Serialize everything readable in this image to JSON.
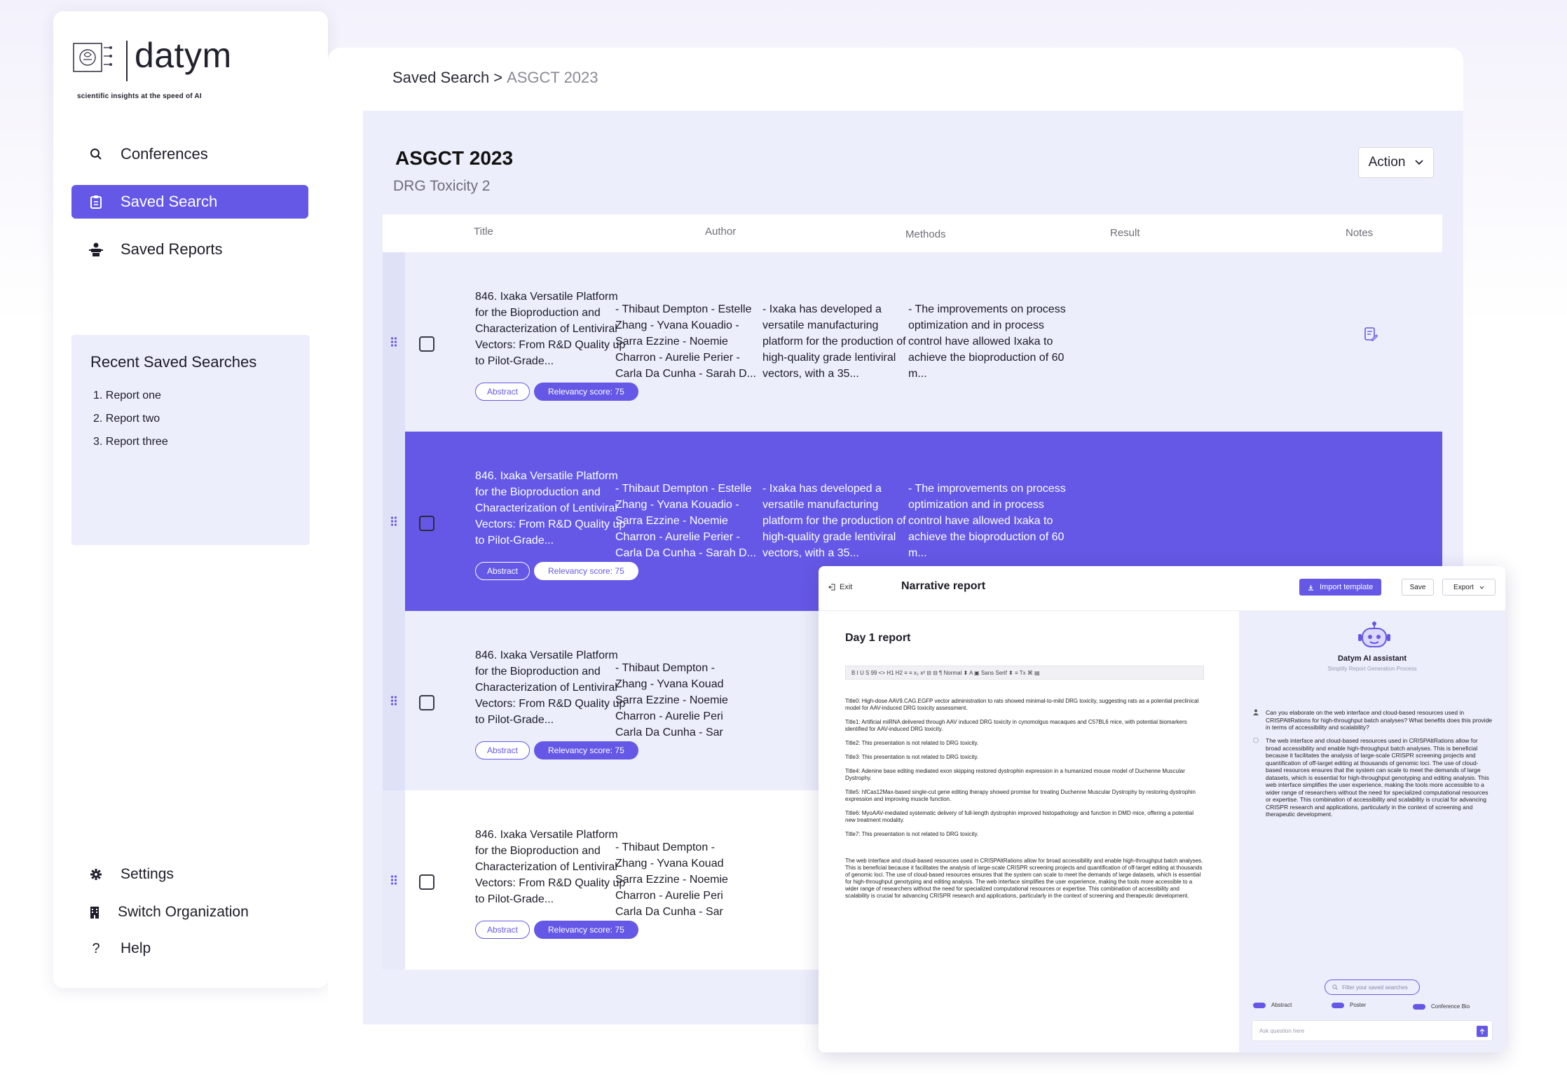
{
  "brand": {
    "name": "datym",
    "tagline": "scientific insights at the speed of AI"
  },
  "nav": {
    "conferences": "Conferences",
    "saved_search": "Saved Search",
    "saved_reports": "Saved Reports"
  },
  "recent": {
    "heading": "Recent Saved Searches",
    "items": [
      "1. Report one",
      "2. Report two",
      "3. Report three"
    ]
  },
  "bottom_nav": {
    "settings": "Settings",
    "switch_org": "Switch Organization",
    "help": "Help"
  },
  "breadcrumb": {
    "parent": "Saved Search",
    "separator": ">",
    "current": "ASGCT 2023"
  },
  "page": {
    "title": "ASGCT 2023",
    "subtitle": "DRG Toxicity 2",
    "action_label": "Action"
  },
  "table": {
    "headers": {
      "title": "Title",
      "author": "Author",
      "methods": "Methods",
      "result": "Result",
      "notes": "Notes"
    },
    "rows": [
      {
        "title": "846. Ixaka Versatile Platform for the Bioproduction and Characterization of Lentiviral Vectors: From R&D Quality up to Pilot-Grade...",
        "author": "- Thibaut Dempton - Estelle Zhang - Yvana Kouadio - Sarra Ezzine - Noemie Charron - Aurelie Perier - Carla Da Cunha - Sarah D...",
        "methods": "- Ixaka has developed a versatile manufacturing platform for the production of high-quality grade lentiviral vectors, with a 35...",
        "result": "- The improvements on process optimization and in process control have allowed Ixaka to achieve the bioproduction of 60 m...",
        "abstract": "Abstract",
        "score": "Relevancy score: 75"
      },
      {
        "title": "846. Ixaka Versatile Platform for the Bioproduction and Characterization of Lentiviral Vectors: From R&D Quality up to Pilot-Grade...",
        "author": "- Thibaut Dempton - Estelle Zhang - Yvana Kouadio - Sarra Ezzine - Noemie Charron - Aurelie Perier - Carla Da Cunha - Sarah D...",
        "methods": "- Ixaka has developed a versatile manufacturing platform for the production of high-quality grade lentiviral vectors, with a 35...",
        "result": "- The improvements on process optimization and in process control have allowed Ixaka to achieve the bioproduction of 60 m...",
        "abstract": "Abstract",
        "score": "Relevancy score: 75"
      },
      {
        "title": "846. Ixaka Versatile Platform for the Bioproduction and Characterization of Lentiviral Vectors: From R&D Quality up to Pilot-Grade...",
        "author": "- Thibaut Dempton - Zhang - Yvana Kouad Sarra Ezzine - Noemie Charron - Aurelie Peri Carla Da Cunha - Sar",
        "abstract": "Abstract",
        "score": "Relevancy score: 75"
      },
      {
        "title": "846. Ixaka Versatile Platform for the Bioproduction and Characterization of Lentiviral Vectors: From R&D Quality up to Pilot-Grade...",
        "author": "- Thibaut Dempton - Zhang - Yvana Kouad Sarra Ezzine - Noemie Charron - Aurelie Peri Carla Da Cunha - Sar",
        "abstract": "Abstract",
        "score": "Relevancy score: 75"
      }
    ]
  },
  "report": {
    "exit_label": "Exit",
    "title": "Narrative report",
    "import_label": "Import template",
    "save_label": "Save",
    "export_label": "Export",
    "doc_heading": "Day 1 report",
    "toolbar": "B  I  U  S   99  <>   H1  H2   ≡  ≡   x₂  x²   ⊟  ⊟   ¶   Normal  ⬍   A  ▣   Sans Serif  ⬍   ≡   Tx   ⌘  ▤",
    "paragraphs": [
      "Title0: High-dose AAV9.CAG.EGFP vector administration to rats showed minimal-to-mild DRG toxicity, suggesting rats as a potential preclinical model for AAV-induced DRG toxicity assessment.",
      "Title1: Artificial miRNA delivered through AAV induced DRG toxicity in cynomolgus macaques and C57BL6 mice, with potential biomarkers identified for AAV-induced DRG toxicity.",
      "Title2: This presentation is not related to DRG toxicity.",
      "Title3: This presentation is not related to DRG toxicity.",
      "Title4: Adenine base editing mediated exon skipping restored dystrophin expression in a humanized mouse model of Duchenne Muscular Dystrophy.",
      "Title5: hfCas12Max-based single-cut gene editing therapy showed promise for treating Duchenne Muscular Dystrophy by restoring dystrophin expression and improving muscle function.",
      "Title6: MyoAAV-mediated systematic delivery of full-length dystrophin improved histopathology and function in DMD mice, offering a potential new treatment modality.",
      "Title7: This presentation is not related to DRG toxicity."
    ],
    "summary": "The web interface and cloud-based resources used in CRISPAltRations allow for broad accessibility and enable high-throughput batch analyses. This is beneficial because it facilitates the analysis of large-scale CRISPR screening projects and quantification of off-target editing at thousands of genomic loci. The use of cloud-based resources ensures that the system can scale to meet the demands of large datasets, which is essential for high-throughput genotyping and editing analysis. The web interface simplifies the user experience, making the tools more accessible to a wider range of researchers without the need for specialized computational resources or expertise. This combination of accessibility and scalability is crucial for advancing CRISPR research and applications, particularly in the context of screening and therapeutic development.",
    "assistant": {
      "name": "Datym AI assistant",
      "subtitle": "Simplify Report Generation Process",
      "question": "Can you elaborate on the web interface and cloud-based resources used in CRISPAltRations for high-throughput batch analyses? What benefits does this provide in terms of accessibility and scalability?",
      "answer": "The web interface and cloud-based resources used in CRISPAltRations allow for broad accessibility and enable high-throughput batch analyses. This is beneficial because it facilitates the analysis of large-scale CRISPR screening projects and quantification of off-target editing at thousands of genomic loci. The use of cloud-based resources ensures that the system can scale to meet the demands of large datasets, which is essential for high-throughput genotyping and editing analysis. This web interface simplifies the user experience, making the tools more accessible to a wider range of researchers without the need for specialized computational resources or expertise. This combination of accessibility and scalability is crucial for advancing CRISPR research and applications, particularly in the context of screening and therapeutic development.",
      "filter_placeholder": "Filter your saved searches",
      "filters": [
        "Abstract",
        "Poster",
        "Conference Bio"
      ],
      "ask_placeholder": "Ask question here"
    }
  },
  "colors": {
    "accent": "#6558e6",
    "panel": "#eceefb"
  }
}
